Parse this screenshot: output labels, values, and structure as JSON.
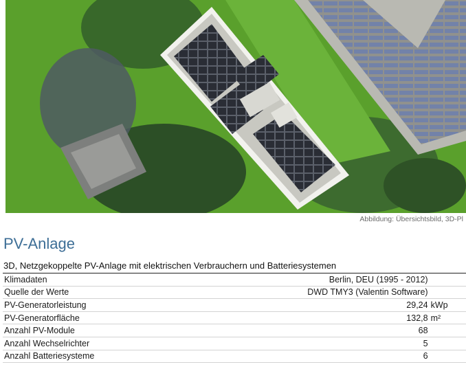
{
  "figure": {
    "caption": "Abbildung: Übersichtsbild, 3D-Pl"
  },
  "section": {
    "title": "PV-Anlage",
    "subtitle": "3D, Netzgekoppelte PV-Anlage mit elektrischen Verbrauchern und Batteriesystemen"
  },
  "table": {
    "rows": [
      {
        "label": "Klimadaten",
        "value": "Berlin, DEU (1995 - 2012)",
        "unit": ""
      },
      {
        "label": "Quelle der Werte",
        "value": "DWD TMY3 (Valentin Software)",
        "unit": ""
      },
      {
        "label": "PV-Generatorleistung",
        "value": "29,24",
        "unit": "kWp"
      },
      {
        "label": "PV-Generatorfläche",
        "value": "132,8",
        "unit": "m²"
      },
      {
        "label": "Anzahl PV-Module",
        "value": "68",
        "unit": ""
      },
      {
        "label": "Anzahl Wechselrichter",
        "value": "5",
        "unit": ""
      },
      {
        "label": "Anzahl Batteriesysteme",
        "value": "6",
        "unit": ""
      }
    ]
  },
  "colors": {
    "title_blue": "#3d6e96",
    "grass": "#5aa02c",
    "roof": "#c9c9c2",
    "panel": "#2b2e36"
  }
}
